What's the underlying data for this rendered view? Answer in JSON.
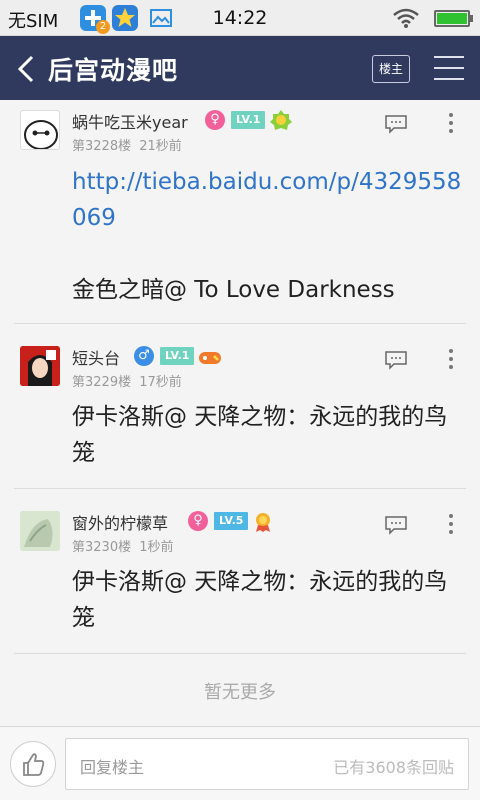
{
  "status_bar": {
    "carrier": "无SIM",
    "time": "14:22",
    "notification_badge": "2"
  },
  "nav": {
    "title": "后宫动漫吧",
    "louzhu_label": "楼主"
  },
  "posts": [
    {
      "username": "蜗牛吃玉米year",
      "gender": "♀",
      "level": "LV.1",
      "floor": "第3228楼",
      "time": "21秒前",
      "link": "http://tieba.baidu.com/p/4329558069",
      "text": "金色之暗@ To Love Darkness"
    },
    {
      "username": "短头台",
      "gender": "♂",
      "level": "LV.1",
      "floor": "第3229楼",
      "time": "17秒前",
      "text": "伊卡洛斯@ 天降之物：永远的我的鸟笼"
    },
    {
      "username": "窗外的柠檬草",
      "gender": "♀",
      "level": "LV.5",
      "floor": "第3230楼",
      "time": "1秒前",
      "text": "伊卡洛斯@ 天降之物：永远的我的鸟笼"
    }
  ],
  "no_more": "暂无更多",
  "bottom": {
    "reply_placeholder": "回复楼主",
    "reply_count": "已有3608条回贴"
  },
  "colors": {
    "nav_bg": "#2f3a5e",
    "link": "#2f74c8",
    "level_badge": "#6fd3c0",
    "female": "#f2609a",
    "male": "#3a8ee6"
  }
}
